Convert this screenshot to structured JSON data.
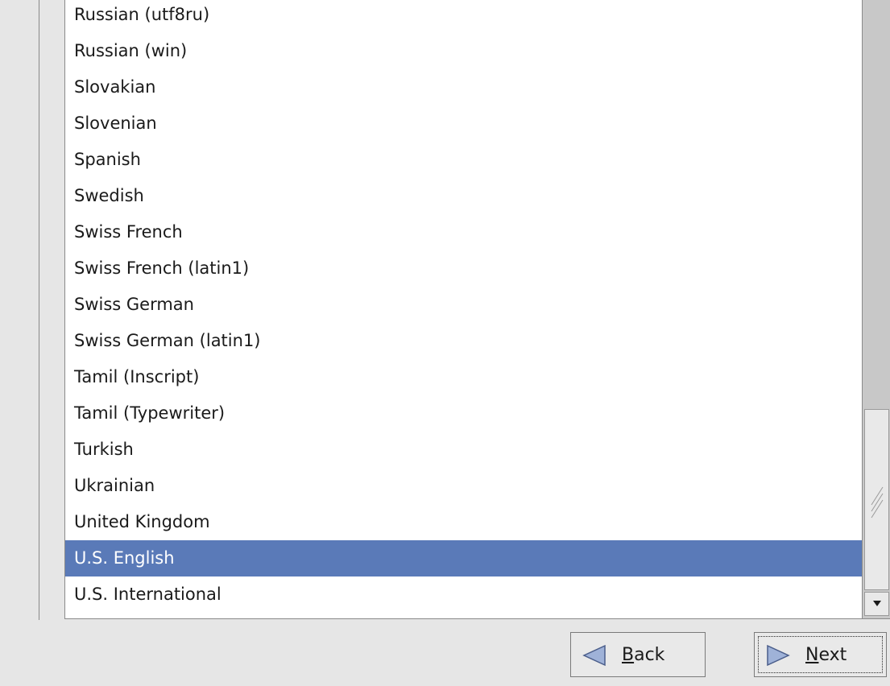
{
  "keyboard_list": {
    "items": [
      "Russian (utf8ru)",
      "Russian (win)",
      "Slovakian",
      "Slovenian",
      "Spanish",
      "Swedish",
      "Swiss French",
      "Swiss French (latin1)",
      "Swiss German",
      "Swiss German (latin1)",
      "Tamil (Inscript)",
      "Tamil (Typewriter)",
      "Turkish",
      "Ukrainian",
      "United Kingdom",
      "U.S. English",
      "U.S. International"
    ],
    "selected": "U.S. English"
  },
  "scrollbar": {
    "position": "bottom"
  },
  "nav": {
    "back": {
      "first": "B",
      "rest": "ack",
      "icon": "left-triangle-icon"
    },
    "next": {
      "first": "N",
      "rest": "ext",
      "icon": "right-triangle-icon"
    }
  },
  "colors": {
    "selection": "#5a7ab8",
    "arrow_icon": "#9fb2d8"
  }
}
